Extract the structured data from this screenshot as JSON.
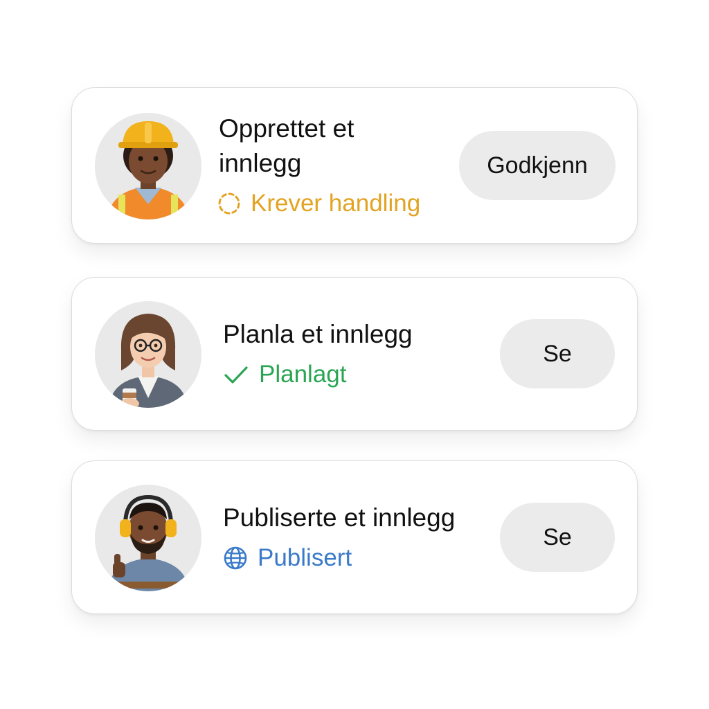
{
  "activity": [
    {
      "avatar_icon": "construction-worker-avatar",
      "title": "Opprettet et innlegg",
      "status": {
        "label": "Krever handling",
        "icon": "pending-dashed-circle-icon",
        "color": "#e3a322"
      },
      "action_label": "Godkjenn"
    },
    {
      "avatar_icon": "office-woman-avatar",
      "title": "Planla et innlegg",
      "status": {
        "label": "Planlagt",
        "icon": "checkmark-icon",
        "color": "#2aa553"
      },
      "action_label": "Se"
    },
    {
      "avatar_icon": "craftsman-headphones-avatar",
      "title": "Publiserte et innlegg",
      "status": {
        "label": "Publisert",
        "icon": "globe-icon",
        "color": "#3a7ac9"
      },
      "action_label": "Se"
    }
  ]
}
